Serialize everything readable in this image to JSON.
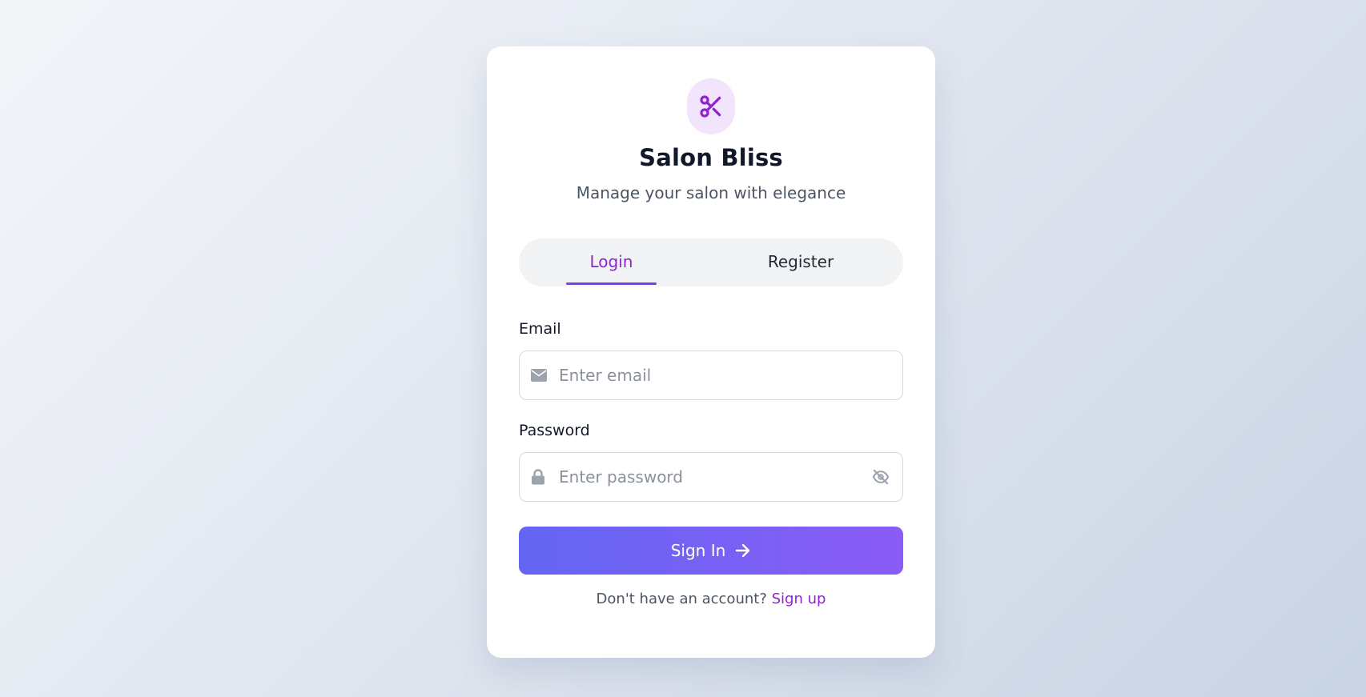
{
  "app": {
    "title": "Salon Bliss",
    "subtitle": "Manage your salon with elegance",
    "logo_icon": "scissors-icon",
    "accent_color": "#9122d1",
    "button_gradient": [
      "#6366f1",
      "#8b5cf6"
    ]
  },
  "tabs": {
    "login_label": "Login",
    "register_label": "Register",
    "active": "Login"
  },
  "form": {
    "email_label": "Email",
    "email_placeholder": "Enter email",
    "email_value": "",
    "email_icon": "envelope-icon",
    "password_label": "Password",
    "password_placeholder": "Enter password",
    "password_value": "",
    "password_icon": "lock-icon",
    "visibility_icon": "eye-slash-icon",
    "submit_label": "Sign In",
    "submit_icon": "arrow-right-icon"
  },
  "footer": {
    "prompt_text": "Don't have an account?",
    "link_text": "Sign up"
  }
}
